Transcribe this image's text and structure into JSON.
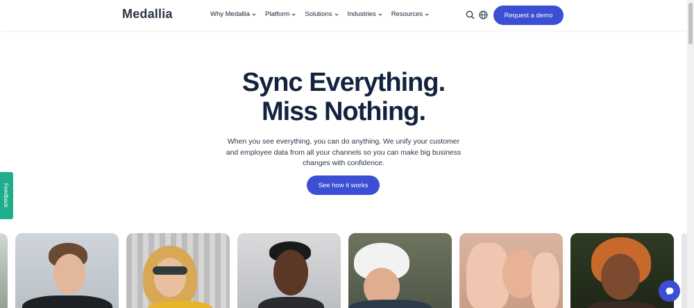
{
  "header": {
    "logo": "Medallia",
    "nav": [
      {
        "label": "Why Medallia"
      },
      {
        "label": "Platform"
      },
      {
        "label": "Solutions"
      },
      {
        "label": "Industries"
      },
      {
        "label": "Resources"
      }
    ],
    "icons": [
      "search-icon",
      "globe-icon"
    ],
    "cta_label": "Request a demo"
  },
  "hero": {
    "title_line1": "Sync Everything.",
    "title_line2": "Miss Nothing.",
    "description": "When you see everything, you can do anything. We unify your customer and employee data from all your channels so you can make big business changes with confidence.",
    "cta_label": "See how it works"
  },
  "feedback_tab": {
    "label": "Feedback"
  },
  "chat": {
    "icon": "chat-bubble-icon"
  },
  "colors": {
    "accent": "#3b4ed4",
    "feedback": "#1fae8c",
    "heading": "#13233f"
  }
}
